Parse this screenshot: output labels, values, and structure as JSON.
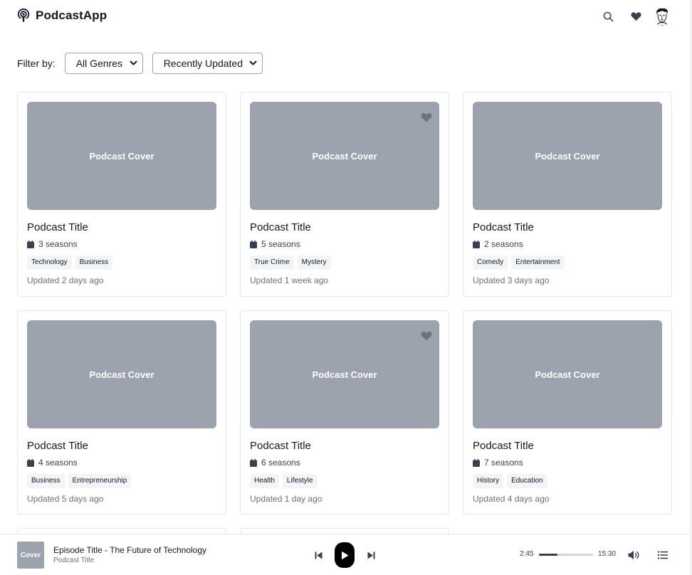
{
  "app": {
    "name": "PodcastApp"
  },
  "header": {
    "icons": [
      "podcast-icon",
      "search-icon",
      "heart-icon",
      "avatar"
    ]
  },
  "filters": {
    "label": "Filter by:",
    "genre": {
      "selected": "All Genres"
    },
    "sort": {
      "selected": "Recently Updated"
    }
  },
  "podcasts": [
    {
      "cover": "Podcast Cover",
      "title": "Podcast Title",
      "seasons": "3 seasons",
      "tags": [
        "Technology",
        "Business"
      ],
      "updated": "Updated 2 days ago",
      "favorite": false
    },
    {
      "cover": "Podcast Cover",
      "title": "Podcast Title",
      "seasons": "5 seasons",
      "tags": [
        "True Crime",
        "Mystery"
      ],
      "updated": "Updated 1 week ago",
      "favorite": true
    },
    {
      "cover": "Podcast Cover",
      "title": "Podcast Title",
      "seasons": "2 seasons",
      "tags": [
        "Comedy",
        "Entertainment"
      ],
      "updated": "Updated 3 days ago",
      "favorite": false
    },
    {
      "cover": "Podcast Cover",
      "title": "Podcast Title",
      "seasons": "4 seasons",
      "tags": [
        "Business",
        "Entrepreneurship"
      ],
      "updated": "Updated 5 days ago",
      "favorite": false
    },
    {
      "cover": "Podcast Cover",
      "title": "Podcast Title",
      "seasons": "6 seasons",
      "tags": [
        "Health",
        "Lifestyle"
      ],
      "updated": "Updated 1 day ago",
      "favorite": true
    },
    {
      "cover": "Podcast Cover",
      "title": "Podcast Title",
      "seasons": "7 seasons",
      "tags": [
        "History",
        "Education"
      ],
      "updated": "Updated 4 days ago",
      "favorite": false
    }
  ],
  "player": {
    "cover": "Cover",
    "episode": "Episode Title - The Future of Technology",
    "show": "Podcast Title",
    "current_time": "2:45",
    "total_time": "15:30",
    "progress": 0.34,
    "icons": [
      "skip-back-icon",
      "play-icon",
      "skip-forward-icon",
      "volume-icon",
      "playlist-icon"
    ]
  },
  "colors": {
    "cover_placeholder": "#9ca3af",
    "tag_bg": "#f3f4f6",
    "border": "#e5e7eb",
    "heart": "#6b7280"
  }
}
